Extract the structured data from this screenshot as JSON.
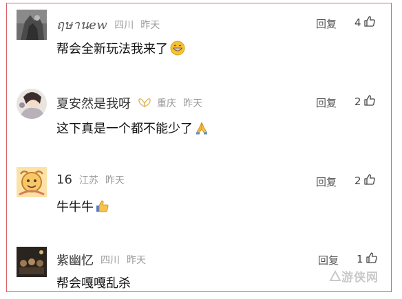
{
  "comments": [
    {
      "username": "ฤษานew",
      "location": "四川",
      "time": "昨天",
      "text": "帮会全新玩法我来了",
      "emoji": "grinning-face-icon",
      "reply_label": "回复",
      "likes": "4"
    },
    {
      "username": "夏安然是我呀",
      "location": "重庆",
      "time": "昨天",
      "text": "这下真是一个都不能少了",
      "emoji": "folded-hands-icon",
      "reply_label": "回复",
      "likes": "2"
    },
    {
      "username": "16",
      "location": "江苏",
      "time": "昨天",
      "text": "牛牛牛",
      "emoji": "thumbs-up-icon",
      "reply_label": "回复",
      "likes": "2"
    },
    {
      "username": "紫幽忆",
      "location": "四川",
      "time": "昨天",
      "text": "帮会嘎嘎乱杀",
      "emoji": "",
      "reply_label": "回复",
      "likes": "1"
    }
  ],
  "watermark": {
    "text": "游侠网"
  },
  "colors": {
    "frame_border": "#d9626a",
    "meta_gray": "#9a9a9a",
    "text": "#111111"
  }
}
